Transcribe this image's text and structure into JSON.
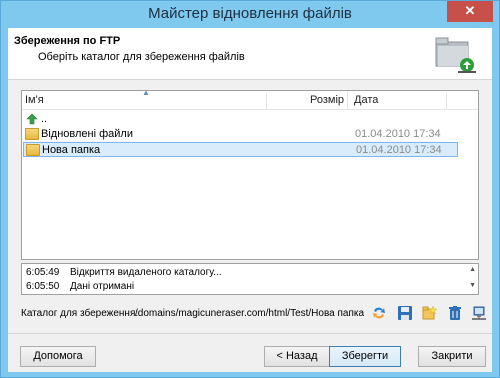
{
  "window": {
    "title": "Майстер відновлення файлів",
    "close_label": "✕"
  },
  "header": {
    "title": "Збереження по FTP",
    "subtitle": "Оберіть каталог для збереження файлів",
    "icon": "folder-network-icon"
  },
  "filelist": {
    "columns": {
      "name": "Ім'я",
      "size": "Розмір",
      "date": "Дата"
    },
    "rows": [
      {
        "name": "..",
        "date": "",
        "icon": "up-arrow-icon"
      },
      {
        "name": "Відновлені файли",
        "date": "01.04.2010 17:34",
        "icon": "folder-icon"
      },
      {
        "name": "Нова папка",
        "date": "01.04.2010 17:34",
        "icon": "folder-icon"
      }
    ]
  },
  "log": {
    "lines": [
      {
        "time": "6:05:49",
        "message": "Відкриття видаленого каталогу..."
      },
      {
        "time": "6:05:50",
        "message": "Дані отримані"
      }
    ]
  },
  "save": {
    "label": "Каталог для збереження:",
    "path": "/domains/magicuneraser.com/html/Test/Нова папка"
  },
  "buttons": {
    "help": "Допомога",
    "back": "< Назад",
    "save": "Зберегти",
    "close": "Закрити"
  },
  "colors": {
    "title_bar": "#7fc9ef",
    "close_button": "#c7504b",
    "selection": "#d9ecfb"
  }
}
